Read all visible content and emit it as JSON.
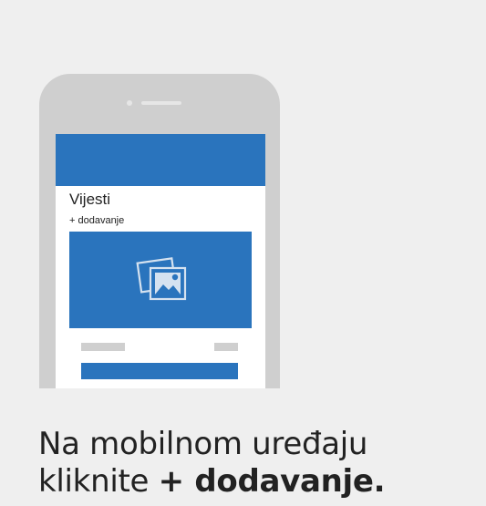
{
  "phone": {
    "screen": {
      "news_title": "Vijesti",
      "add_link": "+ dodavanje"
    }
  },
  "caption": {
    "line1": "Na mobilnom uređaju",
    "line2_prefix": "kliknite ",
    "line2_bold": "+ dodavanje."
  },
  "colors": {
    "background": "#efefef",
    "phone_frame": "#cfcfcf",
    "accent_blue": "#2a74bd",
    "screen": "#ffffff",
    "text": "#222222"
  },
  "icons": {
    "image_placeholder": "image-icon"
  }
}
